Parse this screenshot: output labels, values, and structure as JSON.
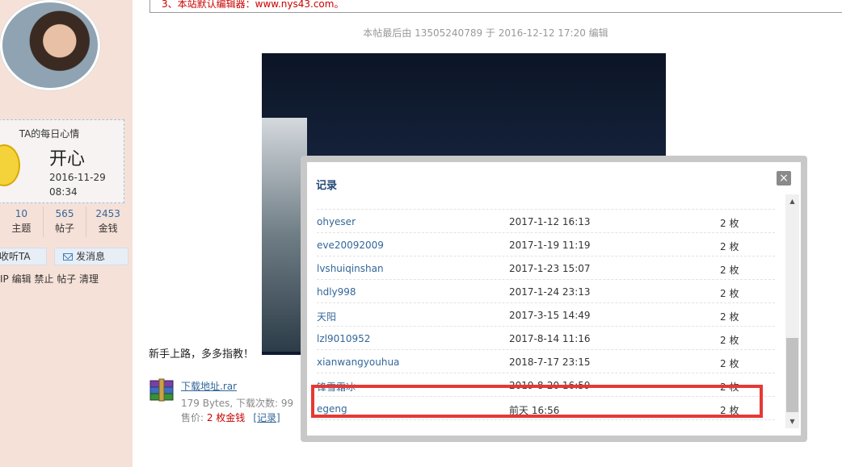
{
  "notice": "3、本站默认编辑器：www.nys43.com。",
  "edit_note": "本帖最后由 13505240789 于 2016-12-12 17:20 编辑",
  "sidebar": {
    "mood": {
      "title": "TA的每日心情",
      "text": "开心",
      "date": "2016-11-29 08:34"
    },
    "stats": [
      {
        "value": "10",
        "label": "主题"
      },
      {
        "value": "565",
        "label": "帖子"
      },
      {
        "value": "2453",
        "label": "金钱"
      }
    ],
    "listen_label": "收听TA",
    "message_label": "发消息",
    "admin_links": "IP 编辑 禁止 帖子 清理"
  },
  "post": {
    "greeting": "新手上路，多多指教！",
    "attachment": {
      "name": "下载地址.rar",
      "meta": "179 Bytes, 下载次数: 99",
      "price_label": "售价: ",
      "price_value": "2 枚金钱",
      "record_link": "[记录]"
    }
  },
  "dialog": {
    "title": "记录",
    "close_label": "×",
    "records": [
      {
        "user": "ohyeser",
        "time": "2017-1-12 16:13",
        "amount": "2 枚"
      },
      {
        "user": "eve20092009",
        "time": "2017-1-19 11:19",
        "amount": "2 枚"
      },
      {
        "user": "lvshuiqinshan",
        "time": "2017-1-23 15:07",
        "amount": "2 枚"
      },
      {
        "user": "hdly998",
        "time": "2017-1-24 23:13",
        "amount": "2 枚"
      },
      {
        "user": "天阳",
        "time": "2017-3-15 14:49",
        "amount": "2 枚"
      },
      {
        "user": "lzl9010952",
        "time": "2017-8-14 11:16",
        "amount": "2 枚"
      },
      {
        "user": "xianwangyouhua",
        "time": "2018-7-17 23:15",
        "amount": "2 枚"
      },
      {
        "user": "锋雪霜冰",
        "time": "2019-8-20 16:59",
        "amount": "2 枚"
      },
      {
        "user": "egeng",
        "time": "前天 16:56",
        "amount": "2 枚"
      }
    ]
  },
  "colors": {
    "link": "#336699",
    "highlight": "#e53935",
    "price": "#cc0000"
  }
}
